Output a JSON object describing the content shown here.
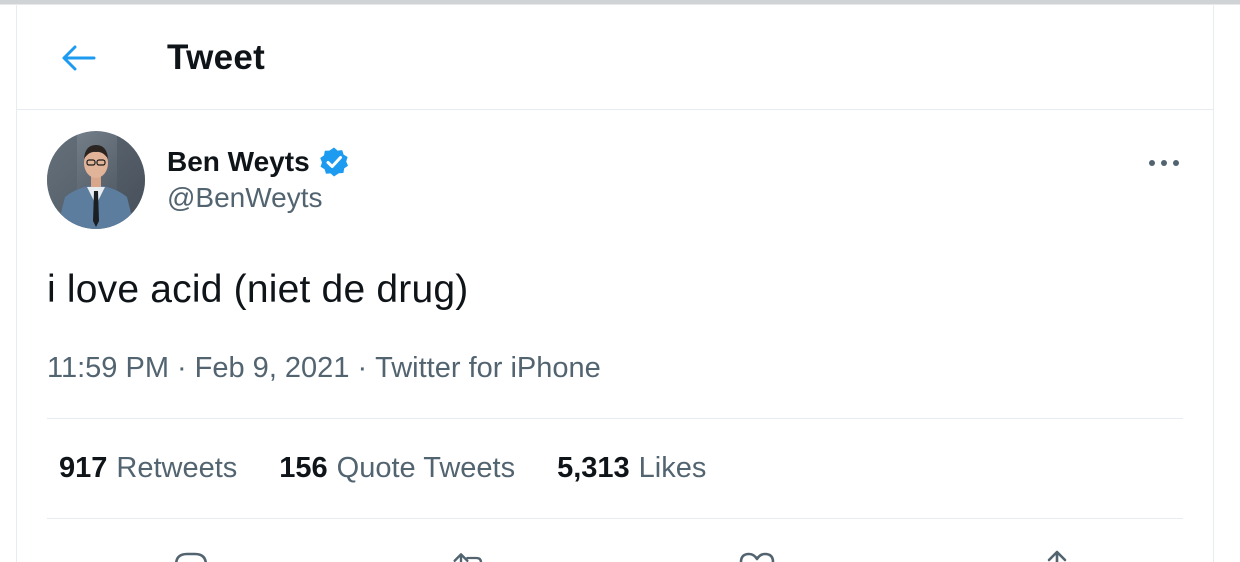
{
  "header": {
    "title": "Tweet",
    "back_icon": "arrow-left-icon"
  },
  "tweet": {
    "author": {
      "name": "Ben Weyts",
      "handle": "@BenWeyts",
      "verified": true
    },
    "text": "i love acid (niet de drug)",
    "time": "11:59 PM",
    "date": "Feb 9, 2021",
    "source": "Twitter for iPhone",
    "meta_separator": "·"
  },
  "stats": [
    {
      "count": "917",
      "label": "Retweets"
    },
    {
      "count": "156",
      "label": "Quote Tweets"
    },
    {
      "count": "5,313",
      "label": "Likes"
    }
  ],
  "actions": [
    "reply-icon",
    "retweet-icon",
    "like-icon",
    "share-icon"
  ],
  "colors": {
    "accent": "#1d9bf0",
    "text_primary": "#0f1419",
    "text_secondary": "#536471",
    "divider": "#e6ecf0"
  }
}
